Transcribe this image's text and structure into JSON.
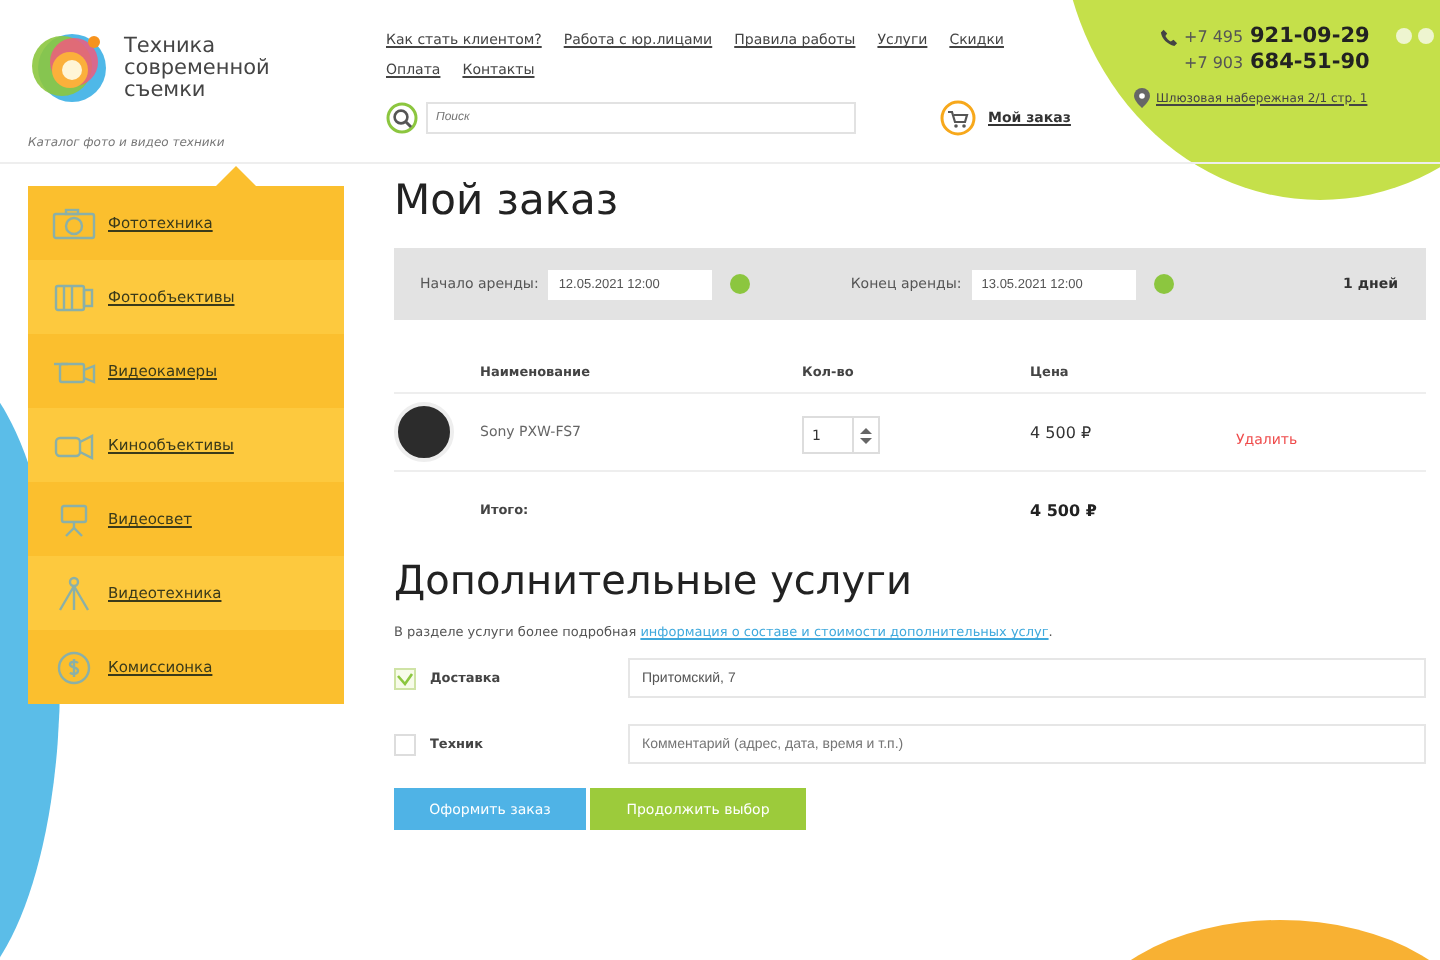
{
  "header": {
    "logo_lines": [
      "Техника",
      "современной",
      "съемки"
    ],
    "tagline": "Каталог фото и видео техники",
    "nav": [
      "Как стать клиентом?",
      "Работа с юр.лицами",
      "Правила работы",
      "Услуги",
      "Скидки",
      "Оплата",
      "Контакты"
    ],
    "search": {
      "placeholder": "Поиск"
    },
    "cart": "Мой заказ",
    "phones": [
      {
        "prefix": "+7 495",
        "number": "921-09-29"
      },
      {
        "prefix": "+7 903",
        "number": "684-51-90"
      }
    ],
    "address": "Шлюзовая набережная 2/1 стр. 1"
  },
  "sidebar": {
    "items": [
      {
        "label": "Фототехника",
        "kind": "camera"
      },
      {
        "label": "Фотообъективы",
        "kind": "lens"
      },
      {
        "label": "Видеокамеры",
        "kind": "camcorder"
      },
      {
        "label": "Кинообъективы",
        "kind": "cinelens"
      },
      {
        "label": "Видеосвет",
        "kind": "light"
      },
      {
        "label": "Видеотехника",
        "kind": "tripod"
      },
      {
        "label": "Комиссионка",
        "kind": "coin"
      }
    ]
  },
  "order": {
    "title": "Мой заказ",
    "start_label": "Начало аренды:",
    "start_value": "12.05.2021 12:00",
    "end_label": "Конец аренды:",
    "end_value": "13.05.2021 12:00",
    "days": "1 дней",
    "columns": [
      "Наименование",
      "Кол-во",
      "Цена"
    ],
    "rows": [
      {
        "name": "Sony PXW-FS7",
        "qty": "1",
        "price": "4 500 ₽",
        "action": "Удалить"
      }
    ],
    "total_label": "Итого:",
    "total_value": "4 500 ₽"
  },
  "services": {
    "title": "Дополнительные услуги",
    "intro": "В разделе услуги более подробная",
    "link": "информация о составе и стоимости дополнительных услуг",
    "intro_end": ".",
    "items": [
      {
        "label": "Доставка",
        "checked": true,
        "value": "Притомский, 7"
      },
      {
        "label": "Техник",
        "checked": false,
        "placeholder": "Комментарий (адрес, дата, время и т.п.)"
      }
    ],
    "buttons": [
      {
        "label": "Оформить заказ",
        "kind": "primary"
      },
      {
        "label": "Продолжить выбор",
        "kind": "secondary"
      }
    ]
  }
}
